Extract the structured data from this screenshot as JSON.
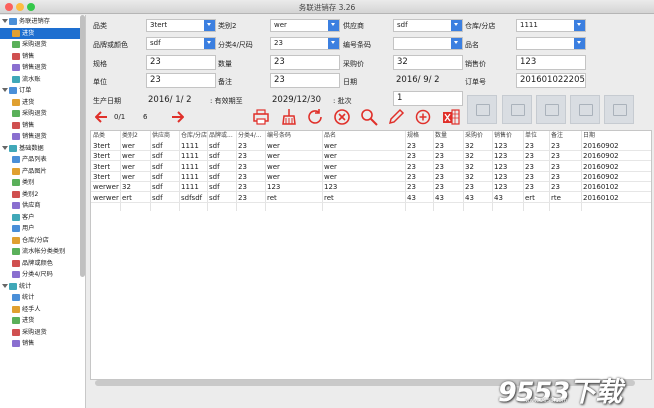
{
  "app": {
    "title": "务联进销存 3.26"
  },
  "sidebar": {
    "items": [
      {
        "label": "务联进销存",
        "group": true,
        "sel": false
      },
      {
        "label": "进货",
        "group": false,
        "sel": true
      },
      {
        "label": "采购退货",
        "group": false,
        "sel": false
      },
      {
        "label": "销售",
        "group": false,
        "sel": false
      },
      {
        "label": "销售退货",
        "group": false,
        "sel": false
      },
      {
        "label": "流水账",
        "group": false,
        "sel": false
      },
      {
        "label": "订单",
        "group": true,
        "sel": false
      },
      {
        "label": "进货",
        "group": false,
        "sel": false
      },
      {
        "label": "采购退货",
        "group": false,
        "sel": false
      },
      {
        "label": "销售",
        "group": false,
        "sel": false
      },
      {
        "label": "销售退货",
        "group": false,
        "sel": false
      },
      {
        "label": "基础数据",
        "group": true,
        "sel": false
      },
      {
        "label": "产品列表",
        "group": false,
        "sel": false
      },
      {
        "label": "产品图片",
        "group": false,
        "sel": false
      },
      {
        "label": "类别",
        "group": false,
        "sel": false
      },
      {
        "label": "类别2",
        "group": false,
        "sel": false
      },
      {
        "label": "供应商",
        "group": false,
        "sel": false
      },
      {
        "label": "客户",
        "group": false,
        "sel": false
      },
      {
        "label": "用户",
        "group": false,
        "sel": false
      },
      {
        "label": "仓库/分店",
        "group": false,
        "sel": false
      },
      {
        "label": "流水帐分类类别",
        "group": false,
        "sel": false
      },
      {
        "label": "品牌或颜色",
        "group": false,
        "sel": false
      },
      {
        "label": "分类4/尺码",
        "group": false,
        "sel": false
      },
      {
        "label": "统计",
        "group": true,
        "sel": false
      },
      {
        "label": "统计",
        "group": false,
        "sel": false
      },
      {
        "label": "经手人",
        "group": false,
        "sel": false
      },
      {
        "label": "进货",
        "group": false,
        "sel": false
      },
      {
        "label": "采购退货",
        "group": false,
        "sel": false
      },
      {
        "label": "销售",
        "group": false,
        "sel": false
      }
    ]
  },
  "form": {
    "category_label": "品类",
    "category_value": "3tert",
    "category2_label": "类别2",
    "category2_value": "wer",
    "supplier_label": "供应商",
    "supplier_value": "sdf",
    "warehouse_label": "仓库/分店",
    "warehouse_value": "1111",
    "brand_label": "品牌或颜色",
    "brand_value": "sdf",
    "class4_label": "分类4/尺码",
    "class4_value": "23",
    "barcode_label": "编号条码",
    "barcode_value": "",
    "name_label": "品名",
    "name_value": "",
    "spec_label": "规格",
    "spec_value": "23",
    "qty_label": "数量",
    "qty_value": "23",
    "cost_label": "采购价",
    "cost_value": "32",
    "price_label": "销售价",
    "price_value": "123",
    "unit_label": "单位",
    "unit_value": "23",
    "note_label": "备注",
    "note_value": "23",
    "date_label": "日期",
    "date_value": "2016/  9/  2",
    "order_label": "订单号",
    "order_value": "20160102220501",
    "prod_date_label": "生产日期",
    "prod_date_value": "2016/  1/  2",
    "expiry_label": ": 有效期至",
    "expiry_value": "2029/12/30",
    "batch_label": ": 批次",
    "batch_value": "1"
  },
  "nav": {
    "page": "0/1",
    "count": "6"
  },
  "toolbar": {
    "prev": "prev-icon",
    "next": "next-icon",
    "print": "print-icon",
    "clear": "broom-icon",
    "refresh": "refresh-icon",
    "delete": "delete-icon",
    "search": "search-icon",
    "edit": "edit-icon",
    "add": "add-icon",
    "excel": "excel-icon"
  },
  "table": {
    "headers": [
      "品类",
      "类别2",
      "供应商",
      "仓库/分店",
      "品牌或...",
      "分类4/...",
      "编号条码",
      "品名",
      "规格",
      "数量",
      "采购价",
      "销售价",
      "单位",
      "备注",
      "日期"
    ],
    "rows": [
      [
        "3tert",
        "wer",
        "sdf",
        "1111",
        "sdf",
        "23",
        "wer",
        "wer",
        "23",
        "23",
        "32",
        "123",
        "23",
        "23",
        "20160902"
      ],
      [
        "3tert",
        "wer",
        "sdf",
        "1111",
        "sdf",
        "23",
        "wer",
        "wer",
        "23",
        "23",
        "32",
        "123",
        "23",
        "23",
        "20160902"
      ],
      [
        "3tert",
        "wer",
        "sdf",
        "1111",
        "sdf",
        "23",
        "wer",
        "wer",
        "23",
        "23",
        "32",
        "123",
        "23",
        "23",
        "20160902"
      ],
      [
        "3tert",
        "wer",
        "sdf",
        "1111",
        "sdf",
        "23",
        "wer",
        "wer",
        "23",
        "23",
        "32",
        "123",
        "23",
        "23",
        "20160902"
      ],
      [
        "werwer",
        "32",
        "sdf",
        "1111",
        "sdf",
        "23",
        "123",
        "123",
        "23",
        "23",
        "23",
        "123",
        "23",
        "23",
        "20160102"
      ],
      [
        "werwer",
        "ert",
        "sdf",
        "sdfsdf",
        "sdf",
        "23",
        "ret",
        "ret",
        "43",
        "43",
        "43",
        "43",
        "ert",
        "rte",
        "20160102"
      ]
    ]
  },
  "watermark": {
    "main": "9553下载",
    "sub": "www.9553.com"
  },
  "colors": {
    "accent": "#1e6fd0",
    "red": "#e0302a",
    "dropdown": "#3b7fe0"
  }
}
